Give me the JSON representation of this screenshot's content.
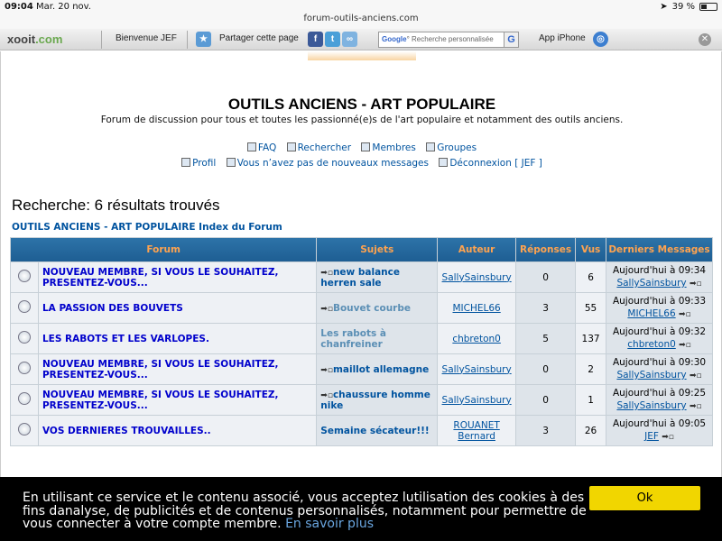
{
  "status": {
    "time": "09:04",
    "date": "Mar. 20 nov.",
    "url": "forum-outils-anciens.com",
    "battery": "39 %"
  },
  "toolbar": {
    "logo_prefix": "xooit",
    "logo_suffix": ".com",
    "welcome": "Bienvenue JEF",
    "share": "Partager cette page",
    "search_placeholder": "Recherche personnalisée",
    "app": "App iPhone"
  },
  "site": {
    "title": "OUTILS ANCIENS - ART POPULAIRE",
    "description": "Forum de discussion pour tous et toutes les passionné(e)s de l'art populaire et notamment des outils anciens."
  },
  "nav": {
    "row1": [
      "FAQ",
      "Rechercher",
      "Membres",
      "Groupes"
    ],
    "row2": [
      "Profil",
      "Vous n’avez pas de nouveaux messages",
      "Déconnexion [ JEF ]"
    ]
  },
  "heading": "Recherche: 6 résultats trouvés",
  "breadcrumb": "OUTILS ANCIENS - ART POPULAIRE Index du Forum",
  "table": {
    "headers": [
      "Forum",
      "Sujets",
      "Auteur",
      "Réponses",
      "Vus",
      "Derniers Messages"
    ],
    "rows": [
      {
        "forum": "NOUVEAU MEMBRE, SI VOUS LE SOUHAITEZ, PRESENTEZ-VOUS...",
        "subject": "new balance herren sale",
        "subject_icon": true,
        "faded": false,
        "author": "SallySainsbury",
        "replies": "0",
        "views": "6",
        "last_date": "Aujourd'hui à 09:34",
        "last_user": "SallySainsbury"
      },
      {
        "forum": "LA PASSION DES BOUVETS",
        "subject": "Bouvet courbe",
        "subject_icon": true,
        "faded": true,
        "author": "MICHEL66",
        "replies": "3",
        "views": "55",
        "last_date": "Aujourd'hui à 09:33",
        "last_user": "MICHEL66"
      },
      {
        "forum": "LES RABOTS ET LES VARLOPES.",
        "subject": "Les rabots à chanfreiner",
        "subject_icon": false,
        "faded": true,
        "author": "chbreton0",
        "replies": "5",
        "views": "137",
        "last_date": "Aujourd'hui à 09:32",
        "last_user": "chbreton0"
      },
      {
        "forum": "NOUVEAU MEMBRE, SI VOUS LE SOUHAITEZ, PRESENTEZ-VOUS...",
        "subject": "maillot allemagne",
        "subject_icon": true,
        "faded": false,
        "author": "SallySainsbury",
        "replies": "0",
        "views": "2",
        "last_date": "Aujourd'hui à 09:30",
        "last_user": "SallySainsbury"
      },
      {
        "forum": "NOUVEAU MEMBRE, SI VOUS LE SOUHAITEZ, PRESENTEZ-VOUS...",
        "subject": "chaussure homme nike",
        "subject_icon": true,
        "faded": false,
        "author": "SallySainsbury",
        "replies": "0",
        "views": "1",
        "last_date": "Aujourd'hui à 09:25",
        "last_user": "SallySainsbury"
      },
      {
        "forum": "VOS DERNIERES TROUVAILLES..",
        "subject": "Semaine sécateur!!!",
        "subject_icon": false,
        "faded": false,
        "author": "ROUANET Bernard",
        "replies": "3",
        "views": "26",
        "last_date": "Aujourd'hui à 09:05",
        "last_user": "JEF"
      }
    ]
  },
  "cookie": {
    "message": "En utilisant ce service et le contenu associé, vous acceptez lutilisation des cookies à des fins danalyse, de publicités et de contenus personnalisés, notamment pour permettre de vous connecter à votre compte membre.",
    "link": "En savoir plus",
    "ok": "Ok"
  }
}
